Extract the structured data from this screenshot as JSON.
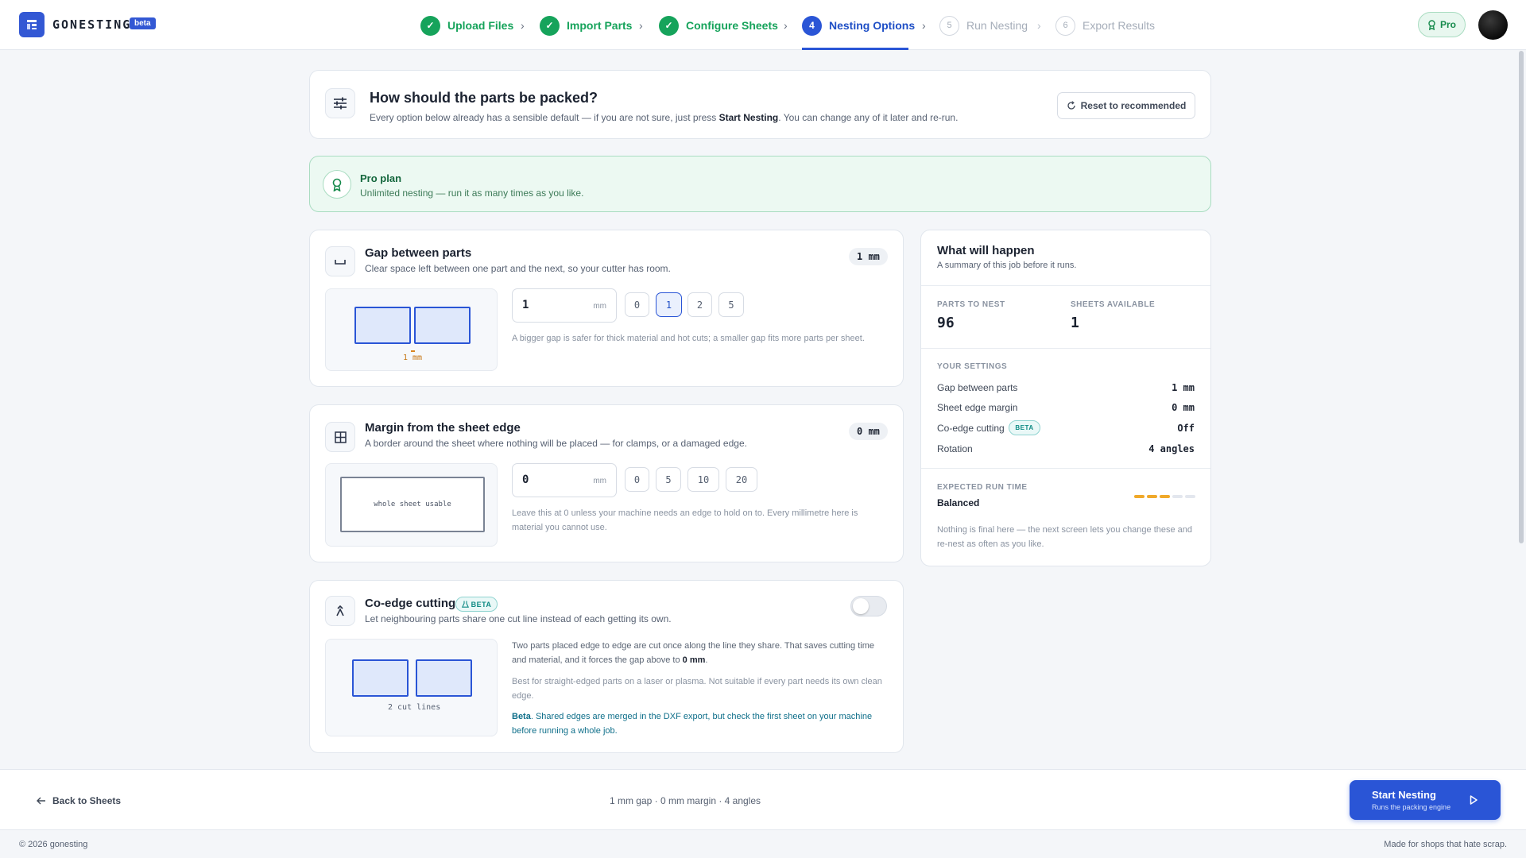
{
  "app": {
    "brand": "GONESTING",
    "beta": "beta"
  },
  "steps": [
    {
      "num": "✓",
      "label": "Upload Files"
    },
    {
      "num": "✓",
      "label": "Import Parts"
    },
    {
      "num": "✓",
      "label": "Configure Sheets"
    },
    {
      "num": "4",
      "label": "Nesting Options"
    },
    {
      "num": "5",
      "label": "Run Nesting"
    },
    {
      "num": "6",
      "label": "Export Results"
    }
  ],
  "account": {
    "plan_label": "Pro"
  },
  "header": {
    "title": "How should the parts be packed?",
    "subtitle_pre": "Every option below already has a sensible default — if you are not sure, just press ",
    "subtitle_bold": "Start Nesting",
    "subtitle_post": ". You can change any of it later and re-run.",
    "reset_label": "Reset to recommended"
  },
  "plan_banner": {
    "title": "Pro plan",
    "text": "Unlimited nesting — run it as many times as you like."
  },
  "gap": {
    "title": "Gap between parts",
    "desc": "Clear space left between one part and the next, so your cutter has room.",
    "badge": "1 mm",
    "input_value": "1",
    "unit": "mm",
    "presets": [
      "0",
      "1",
      "2",
      "5"
    ],
    "selected": "1",
    "preview_label": "1 mm",
    "hint": "A bigger gap is safer for thick material and hot cuts; a smaller gap fits more parts per sheet."
  },
  "margin": {
    "title": "Margin from the sheet edge",
    "desc": "A border around the sheet where nothing will be placed — for clamps, or a damaged edge.",
    "badge": "0 mm",
    "input_value": "0",
    "unit": "mm",
    "presets": [
      "0",
      "5",
      "10",
      "20"
    ],
    "preview_label": "whole sheet usable",
    "hint_1": "Leave this at 0 unless your machine needs an edge to hold on to. Every millimetre here is",
    "hint_2": "material you cannot use."
  },
  "coedge": {
    "title": "Co-edge cutting",
    "beta": "BETA",
    "desc": "Let neighbouring parts share one cut line instead of each getting its own.",
    "toggle_state": "off",
    "preview_label": "2 cut lines",
    "p1_line1": "Two parts placed edge to edge are cut once along the line they share. That saves cutting time",
    "p1_line2_pre": "and material, and it forces the gap above to ",
    "p1_line2_bold": "0 mm",
    "p1_line2_post": ".",
    "p2_line1": "Best for straight-edged parts on a laser or plasma. Not suitable if every part needs its own clean",
    "p2_line2": "edge.",
    "p3_bold": "Beta",
    "p3_line1": ". Shared edges are merged in the DXF export, but check the first sheet on your machine",
    "p3_line2": "before running a whole job."
  },
  "summary": {
    "title": "What will happen",
    "subtitle": "A summary of this job before it runs.",
    "parts_label": "PARTS TO NEST",
    "parts_value": "96",
    "sheets_label": "SHEETS AVAILABLE",
    "sheets_value": "1",
    "settings_label": "YOUR SETTINGS",
    "settings": [
      {
        "label": "Gap between parts",
        "value": "1 mm"
      },
      {
        "label": "Sheet edge margin",
        "value": "0 mm"
      },
      {
        "label": "Co-edge cutting",
        "value": "Off",
        "tag": "BETA"
      },
      {
        "label": "Rotation",
        "value": "4 angles"
      }
    ],
    "runtime_label": "EXPECTED RUN TIME",
    "runtime_value": "Balanced",
    "runtime_level": 3,
    "runtime_max": 5,
    "note_1": "Nothing is final here — the next screen lets you change these and",
    "note_2": "re-nest as often as you like."
  },
  "bottom": {
    "back_label": "Back to Sheets",
    "summary_line": "1 mm gap · 0 mm margin · 4 angles",
    "start_label": "Start Nesting",
    "start_sub": "Runs the packing engine"
  },
  "footer": {
    "left": "© 2026 gonesting",
    "right": "Made for shops that hate scrap."
  },
  "colors": {
    "accent": "#2a55d6",
    "success": "#16a35b",
    "warning": "#f0a92a"
  }
}
